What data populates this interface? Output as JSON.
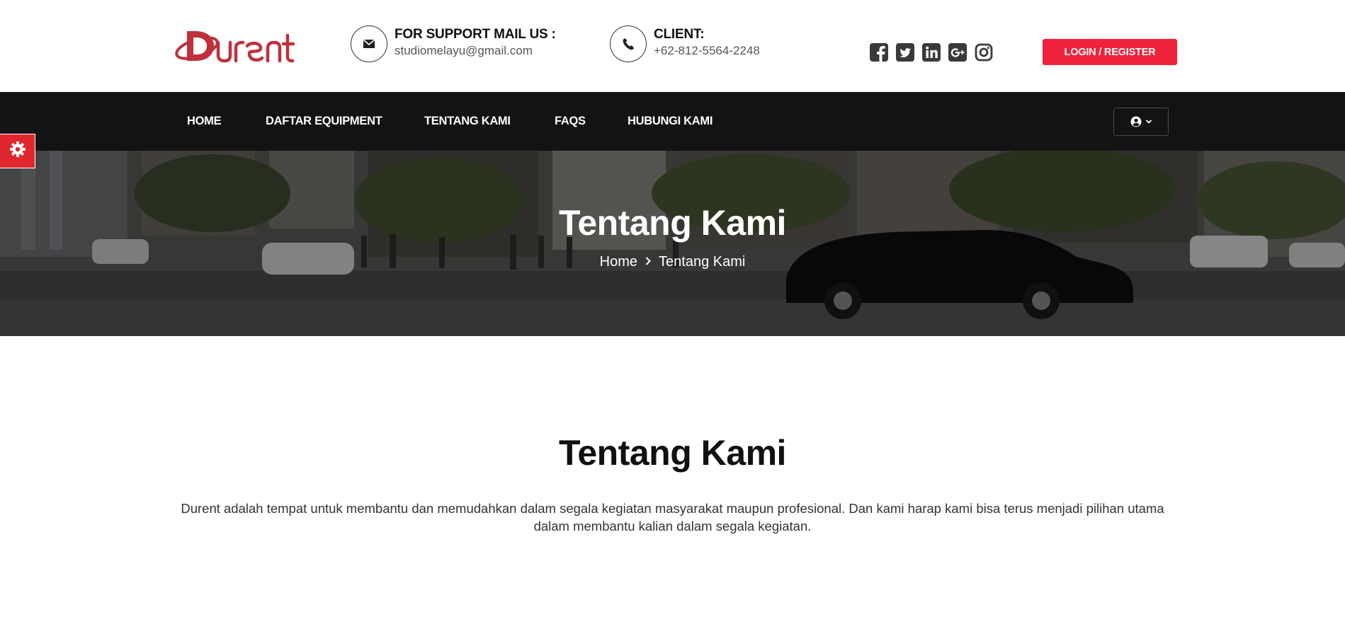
{
  "brand": {
    "name": "Durent",
    "accent": "#c0303a"
  },
  "header": {
    "support_label": "FOR SUPPORT MAIL US :",
    "support_email": "studiomelayu@gmail.com",
    "client_label": "CLIENT:",
    "client_phone": "+62-812-5564-2248",
    "socials": [
      "facebook-icon",
      "twitter-icon",
      "linkedin-icon",
      "google-plus-icon",
      "instagram-icon"
    ],
    "login_label": "LOGIN / REGISTER",
    "login_color": "#f0213a"
  },
  "nav": {
    "items": [
      "HOME",
      "DAFTAR EQUIPMENT",
      "TENTANG KAMI",
      "FAQS",
      "HUBUNGI KAMI"
    ],
    "background": "#131313"
  },
  "hero": {
    "title": "Tentang Kami",
    "breadcrumb_home": "Home",
    "breadcrumb_current": "Tentang Kami"
  },
  "content": {
    "title": "Tentang Kami",
    "text": "Durent adalah tempat untuk membantu dan memudahkan dalam segala kegiatan masyarakat maupun profesional. Dan kami harap kami bisa terus menjadi pilihan utama dalam membantu kalian dalam segala kegiatan."
  }
}
